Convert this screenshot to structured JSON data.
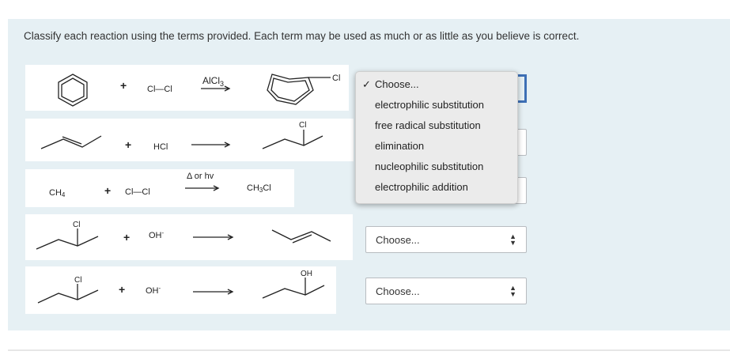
{
  "instructions": "Classify each reaction using the terms provided. Each term may be  used as much or as little as you believe is correct.",
  "reactions": [
    {
      "plus": "+",
      "reagent": "Cl—Cl",
      "catalyst": "AlCl",
      "catalyst_sub": "3",
      "product_label": "Cl"
    },
    {
      "plus": "+",
      "reagent": "HCl",
      "product_label": "Cl"
    },
    {
      "reactant": "CH",
      "reactant_sub": "4",
      "plus": "+",
      "reagent": "Cl—Cl",
      "condition": "Δ or hv",
      "product": "CH",
      "product_sub": "3",
      "product_tail": "Cl"
    },
    {
      "reactant_label": "Cl",
      "plus": "+",
      "reagent": "OH",
      "reagent_sup": "-"
    },
    {
      "reactant_label": "Cl",
      "plus": "+",
      "reagent": "OH",
      "reagent_sup": "-",
      "product_label": "OH"
    }
  ],
  "dropdown": {
    "selected": "Choose...",
    "check": "✓",
    "options": [
      "Choose...",
      "electrophilic substitution",
      "free radical substitution",
      "elimination",
      "nucleophilic substitution",
      "electrophilic addition"
    ]
  },
  "selects": [
    {
      "value": "Choose..."
    },
    {
      "value": "Choose..."
    }
  ],
  "select_arrows": {
    "up": "▲",
    "down": "▼"
  }
}
